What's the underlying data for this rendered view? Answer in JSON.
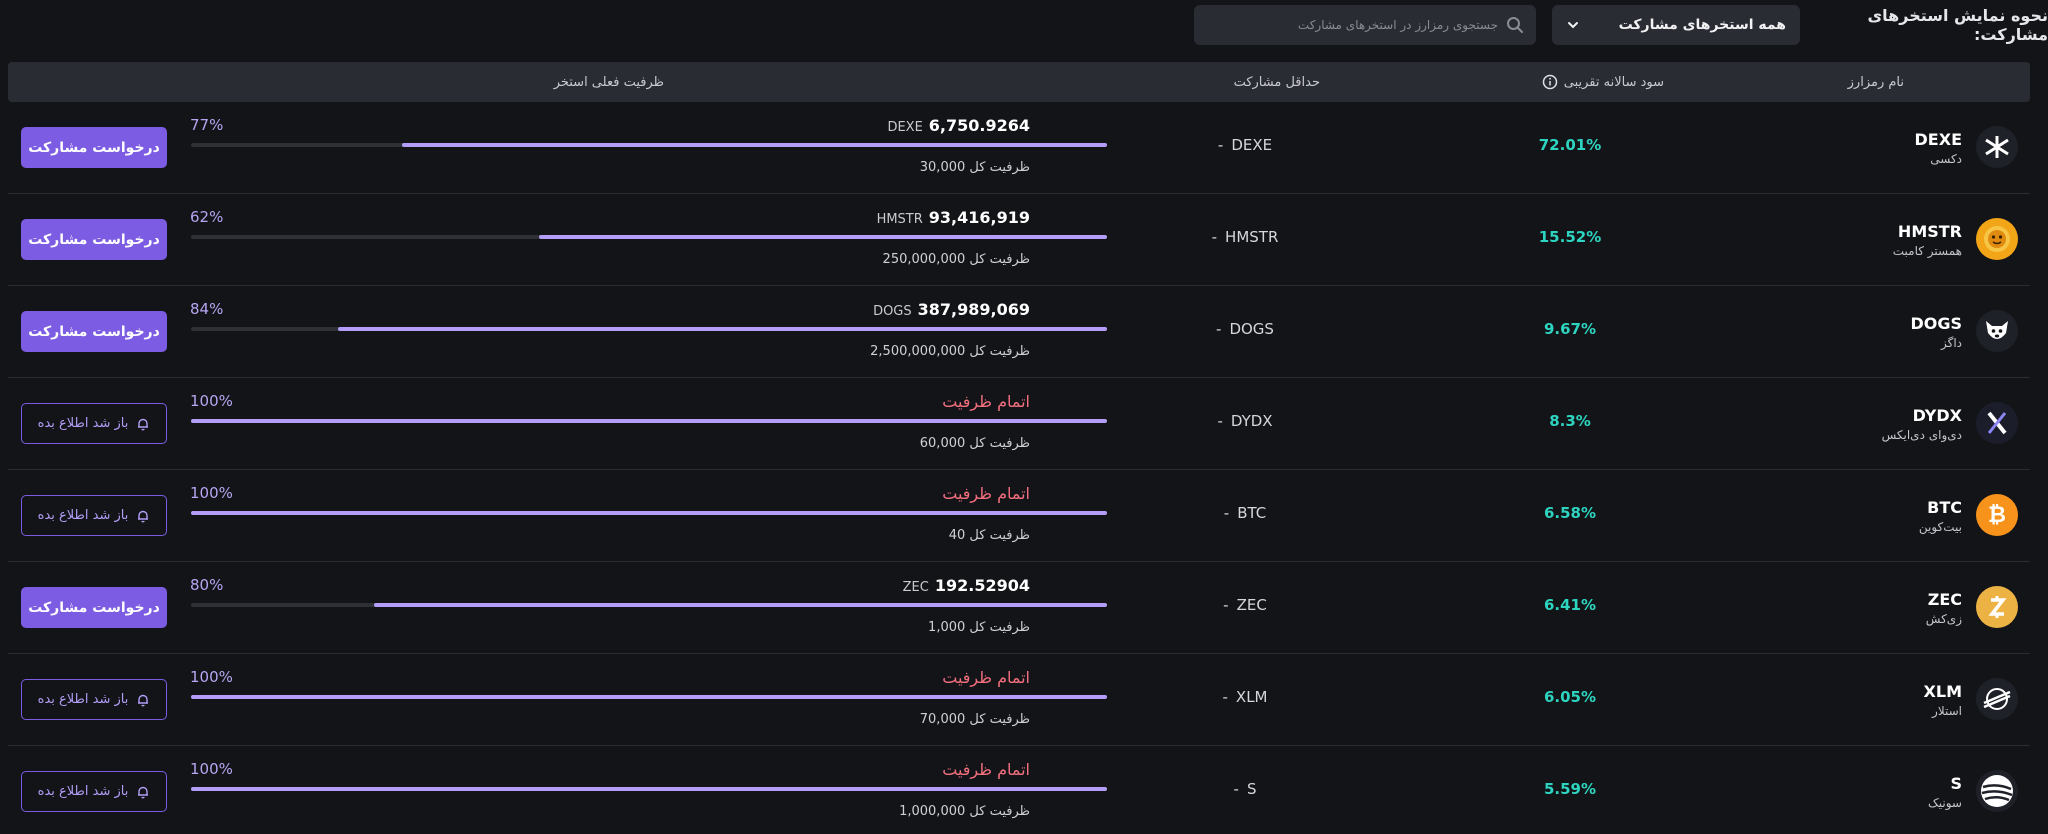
{
  "filters": {
    "label": "نحوه نمایش استخرهای مشارکت:",
    "select_value": "همه استخرهای مشارکت",
    "search_placeholder": "جستجوی رمزارز در استخرهای مشارکت"
  },
  "table": {
    "headers": {
      "name": "نام رمزارز",
      "apy": "سود سالانه تقریبی",
      "min": "حداقل مشارکت",
      "capacity": "ظرفیت فعلی استخر"
    },
    "join_label": "درخواست مشارکت",
    "notify_label": "باز شد اطلاع بده",
    "full_label": "اتمام ظرفیت",
    "total_prefix": "ظرفیت کل",
    "rows": [
      {
        "symbol": "DEXE",
        "fa_name": "دکسی",
        "apy": "72.01%",
        "min_unit": "DEXE",
        "min_value": "-",
        "amount": "6,750.9264",
        "amount_unit": "DEXE",
        "full": false,
        "percent": "77%",
        "fill": 0.77,
        "total": "30,000",
        "action": "join",
        "icon": "dexe-icon",
        "icon_bg": "#1f2128"
      },
      {
        "symbol": "HMSTR",
        "fa_name": "همستر کامبت",
        "apy": "15.52%",
        "min_unit": "HMSTR",
        "min_value": "-",
        "amount": "93,416,919",
        "amount_unit": "HMSTR",
        "full": false,
        "percent": "62%",
        "fill": 0.62,
        "total": "250,000,000",
        "action": "join",
        "icon": "hamster-icon",
        "icon_bg": "#f2a516"
      },
      {
        "symbol": "DOGS",
        "fa_name": "داگز",
        "apy": "9.67%",
        "min_unit": "DOGS",
        "min_value": "-",
        "amount": "387,989,069",
        "amount_unit": "DOGS",
        "full": false,
        "percent": "84%",
        "fill": 0.84,
        "total": "2,500,000,000",
        "action": "join",
        "icon": "dog-icon",
        "icon_bg": "#1f2128"
      },
      {
        "symbol": "DYDX",
        "fa_name": "دی‌وای دی‌ایکس",
        "apy": "8.3%",
        "min_unit": "DYDX",
        "min_value": "-",
        "amount": "",
        "amount_unit": "",
        "full": true,
        "percent": "100%",
        "fill": 1.0,
        "total": "60,000",
        "action": "notify",
        "icon": "dydx-icon",
        "icon_bg": "#1c1d2b"
      },
      {
        "symbol": "BTC",
        "fa_name": "بیت‌کوین",
        "apy": "6.58%",
        "min_unit": "BTC",
        "min_value": "-",
        "amount": "",
        "amount_unit": "",
        "full": true,
        "percent": "100%",
        "fill": 1.0,
        "total": "40",
        "action": "notify",
        "icon": "bitcoin-icon",
        "icon_bg": "#f7931a"
      },
      {
        "symbol": "ZEC",
        "fa_name": "زی‌کش",
        "apy": "6.41%",
        "min_unit": "ZEC",
        "min_value": "-",
        "amount": "192.52904",
        "amount_unit": "ZEC",
        "full": false,
        "percent": "80%",
        "fill": 0.8,
        "total": "1,000",
        "action": "join",
        "icon": "zcash-icon",
        "icon_bg": "#ecb244"
      },
      {
        "symbol": "XLM",
        "fa_name": "استلار",
        "apy": "6.05%",
        "min_unit": "XLM",
        "min_value": "-",
        "amount": "",
        "amount_unit": "",
        "full": true,
        "percent": "100%",
        "fill": 1.0,
        "total": "70,000",
        "action": "notify",
        "icon": "stellar-icon",
        "icon_bg": "#1f2128"
      },
      {
        "symbol": "S",
        "fa_name": "سونیک",
        "apy": "5.59%",
        "min_unit": "S",
        "min_value": "-",
        "amount": "",
        "amount_unit": "",
        "full": true,
        "percent": "100%",
        "fill": 1.0,
        "total": "1,000,000",
        "action": "notify",
        "icon": "sonic-icon",
        "icon_bg": "#1f2128"
      }
    ]
  }
}
